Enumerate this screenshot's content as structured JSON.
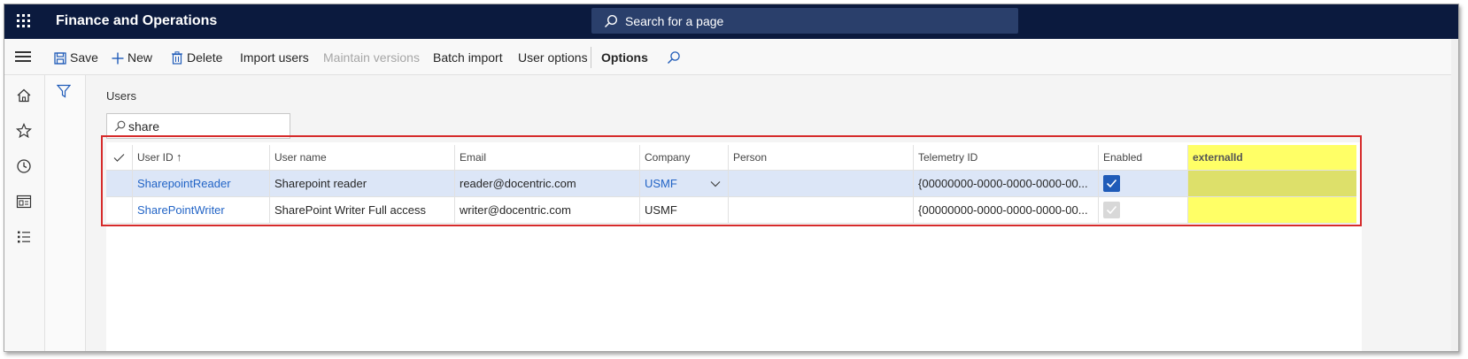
{
  "app": {
    "title": "Finance and Operations"
  },
  "search": {
    "placeholder": "Search for a page"
  },
  "actions": {
    "save": "Save",
    "new": "New",
    "delete": "Delete",
    "import_users": "Import users",
    "maintain_versions": "Maintain versions",
    "batch_import": "Batch import",
    "user_options": "User options",
    "options": "Options"
  },
  "page": {
    "title": "Users"
  },
  "filter": {
    "value": "share"
  },
  "grid": {
    "columns": [
      "User ID",
      "User name",
      "Email",
      "Company",
      "Person",
      "Telemetry ID",
      "Enabled",
      "externalId"
    ],
    "sort_indicator": "↑",
    "rows": [
      {
        "user_id": "SharepointReader",
        "user_name": "Sharepoint reader",
        "email": "reader@docentric.com",
        "company": "USMF",
        "person": "",
        "telemetry_id": "{00000000-0000-0000-0000-00...",
        "enabled": true,
        "external_id": ""
      },
      {
        "user_id": "SharePointWriter",
        "user_name": "SharePoint Writer Full access",
        "email": "writer@docentric.com",
        "company": "USMF",
        "person": "",
        "telemetry_id": "{00000000-0000-0000-0000-00...",
        "enabled": true,
        "external_id": ""
      }
    ]
  },
  "colors": {
    "topbar": "#0b1a3e",
    "accent": "#2264c6",
    "highlight": "#ffff66",
    "annotation": "#d62b2b"
  }
}
